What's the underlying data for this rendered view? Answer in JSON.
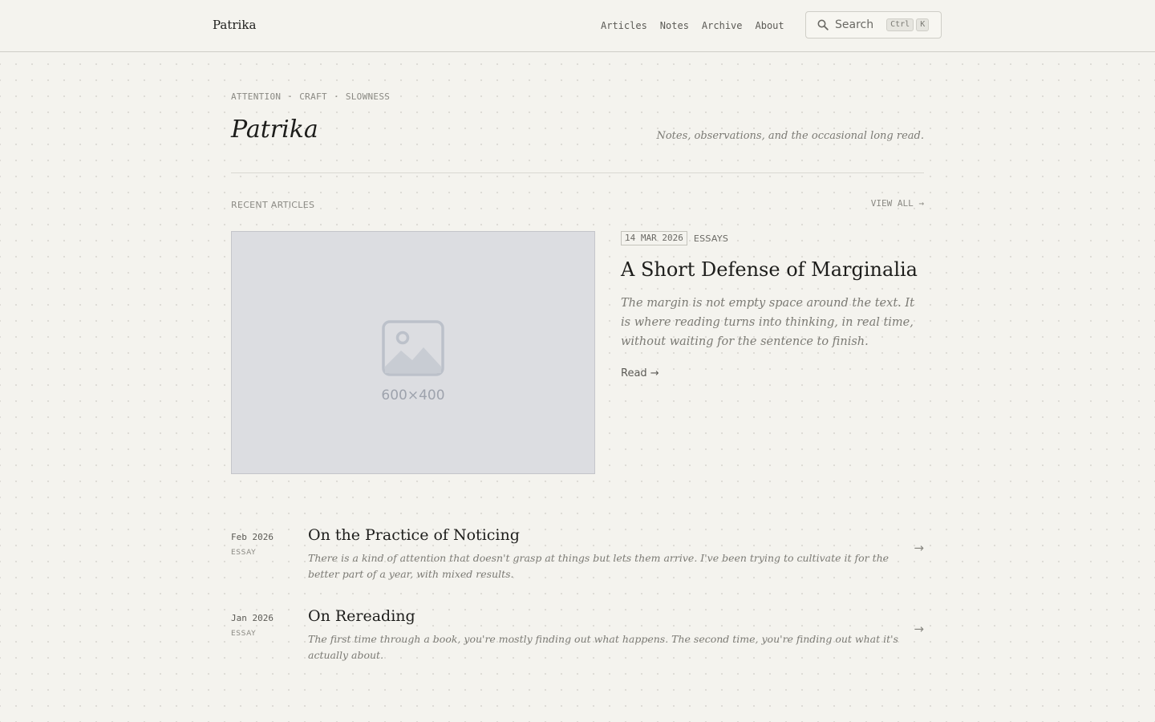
{
  "header": {
    "brand": "Patrika",
    "nav": [
      "Articles",
      "Notes",
      "Archive",
      "About"
    ],
    "search": {
      "label": "Search",
      "shortcut_mod": "Ctrl",
      "shortcut_key": "K"
    }
  },
  "hero": {
    "tags": [
      "ATTENTION",
      "·",
      "CRAFT",
      "·",
      "SLOWNESS"
    ],
    "title": "Patrika",
    "tagline": "Notes, observations, and the occasional long read."
  },
  "recent": {
    "label": "RECENT ARTICLES",
    "view_all": "VIEW ALL →",
    "featured": {
      "image_label": "600×400",
      "date": "14 MAR 2026",
      "category": "ESSAYS",
      "title": "A Short Defense of Marginalia",
      "excerpt": "The margin is not empty space around the text. It is where reading turns into thinking, in real time, without waiting for the sentence to finish.",
      "read": "Read →"
    },
    "items": [
      {
        "date": "Feb 2026",
        "category": "ESSAY",
        "title": "On the Practice of Noticing",
        "excerpt": "There is a kind of attention that doesn't grasp at things but lets them arrive. I've been trying to cultivate it for the better part of a year, with mixed results.",
        "arrow": "→"
      },
      {
        "date": "Jan 2026",
        "category": "ESSAY",
        "title": "On Rereading",
        "excerpt": "The first time through a book, you're mostly finding out what happens. The second time, you're finding out what it's actually about.",
        "arrow": "→"
      }
    ]
  },
  "colors": {
    "background": "#f4f3ee",
    "text": "#1d1d1b",
    "muted": "#7b7a74",
    "placeholder": "#dcdde1"
  },
  "icons": {
    "search": "magnifier-icon",
    "image": "image-placeholder-icon"
  }
}
